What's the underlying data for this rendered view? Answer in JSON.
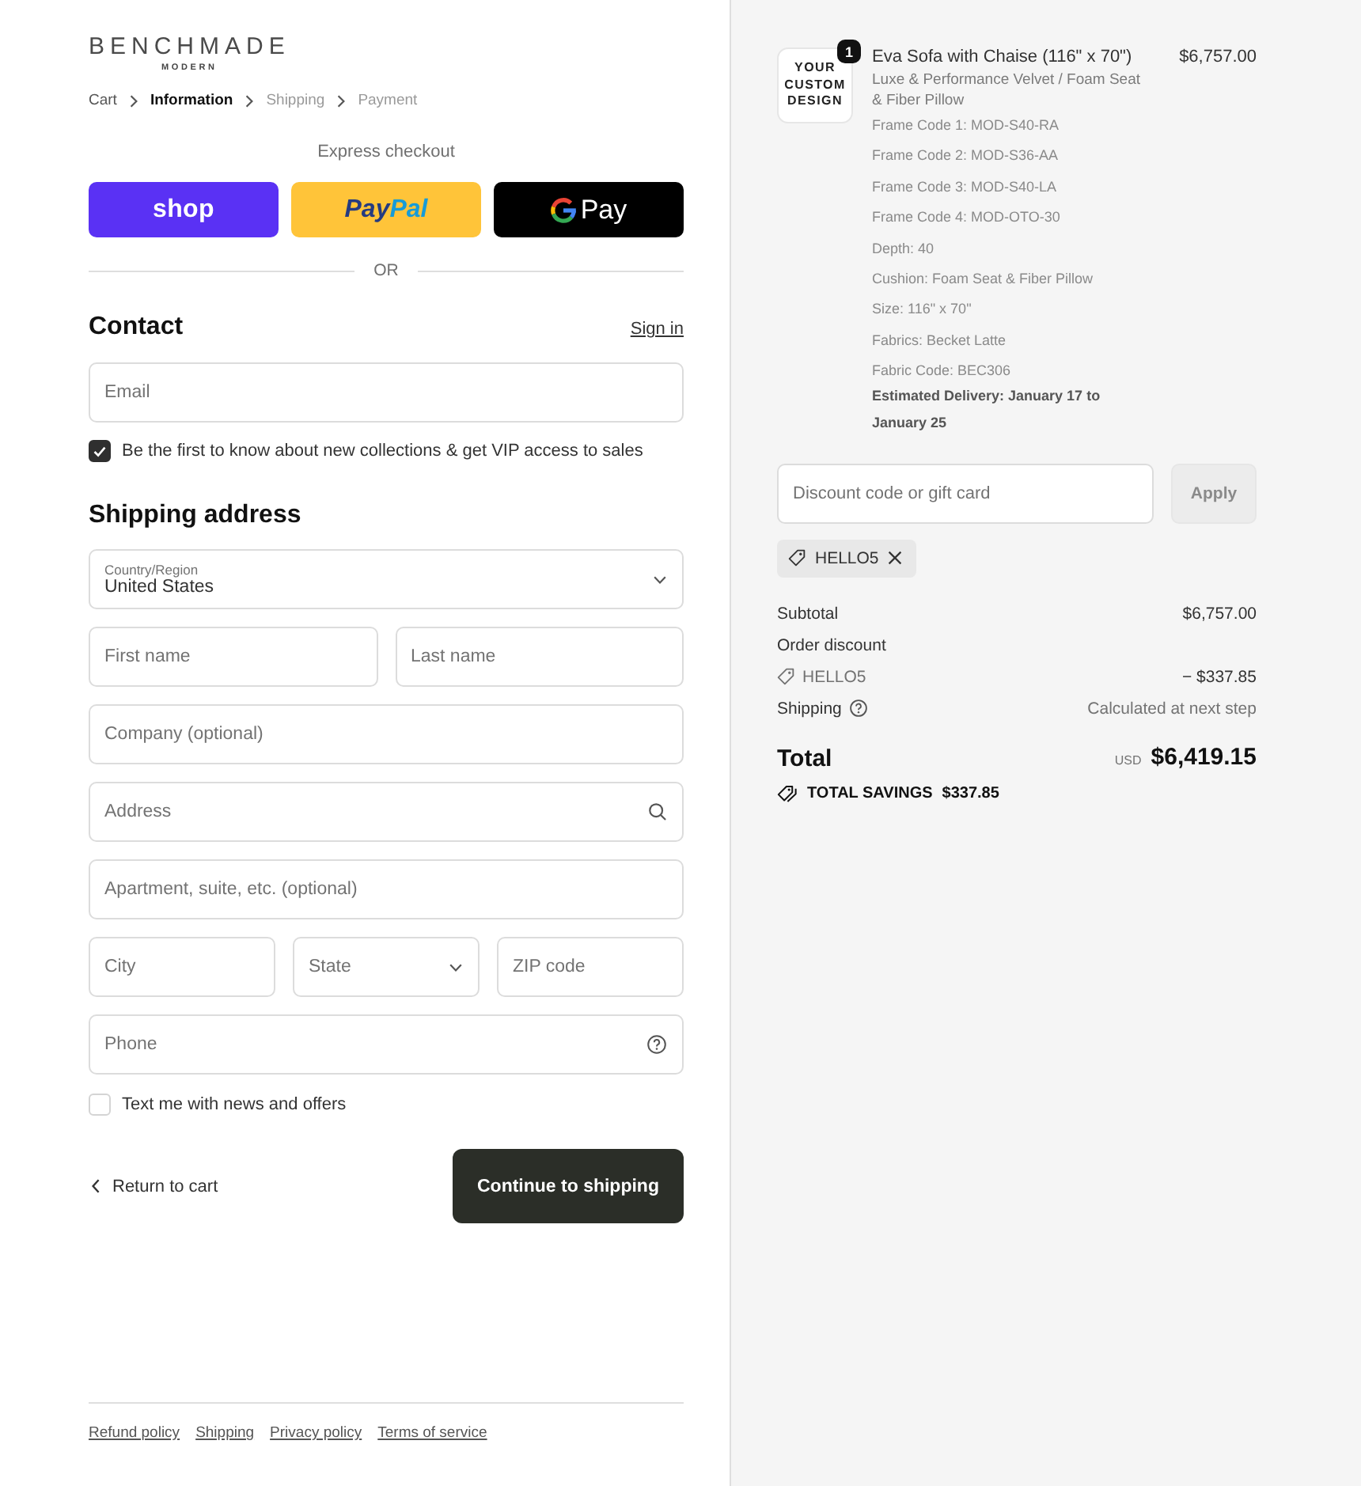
{
  "brand": {
    "name": "BENCHMADE",
    "tagline": "MODERN"
  },
  "breadcrumb": [
    {
      "label": "Cart",
      "selected": false,
      "completed": true
    },
    {
      "label": "Information",
      "selected": true,
      "completed": false
    },
    {
      "label": "Shipping",
      "selected": false,
      "completed": false
    },
    {
      "label": "Payment",
      "selected": false,
      "completed": false
    }
  ],
  "express_checkout": {
    "title": "Express checkout",
    "buttons": [
      {
        "kind": "shop",
        "label": "shop"
      },
      {
        "kind": "paypal",
        "label_parts": [
          "Pay",
          "Pal"
        ]
      },
      {
        "kind": "gpay",
        "label": "Pay"
      }
    ]
  },
  "divider": "OR",
  "contact": {
    "title": "Contact",
    "sign_in": "Sign in",
    "email": {
      "placeholder": "Email"
    },
    "marketing": {
      "label": "Be the first to know about new collections & get VIP access to sales",
      "checked": true
    }
  },
  "shipping_address": {
    "title": "Shipping address",
    "rows": [
      [
        {
          "kind": "select",
          "label": "Country/Region",
          "value": "United States"
        }
      ],
      [
        {
          "kind": "text",
          "placeholder": "First name"
        },
        {
          "kind": "text",
          "placeholder": "Last name"
        }
      ],
      [
        {
          "kind": "text",
          "placeholder": "Company (optional)"
        }
      ],
      [
        {
          "kind": "search",
          "placeholder": "Address"
        }
      ],
      [
        {
          "kind": "text",
          "placeholder": "Apartment, suite, etc. (optional)"
        }
      ],
      [
        {
          "kind": "text",
          "placeholder": "City"
        },
        {
          "kind": "select",
          "placeholder": "State"
        },
        {
          "kind": "text",
          "placeholder": "ZIP code"
        }
      ],
      [
        {
          "kind": "help",
          "placeholder": "Phone"
        }
      ]
    ]
  },
  "sms": {
    "label": "Text me with news and offers",
    "checked": false
  },
  "actions": {
    "back": "Return to cart",
    "continue": "Continue to shipping"
  },
  "footer_links": [
    "Refund policy",
    "Shipping",
    "Privacy policy",
    "Terms of service"
  ],
  "order": {
    "items": [
      {
        "thumbnail_text": "YOUR\nCUSTOM\nDESIGN",
        "quantity": "1",
        "title": "Eva Sofa with Chaise (116\" x 70\")",
        "price": "$6,757.00",
        "variant": "Luxe & Performance Velvet / Foam Seat & Fiber Pillow",
        "properties": [
          "Frame Code 1: MOD-S40-RA",
          "Frame Code 2: MOD-S36-AA",
          "Frame Code 3: MOD-S40-LA",
          "Frame Code 4: MOD-OTO-30",
          "Depth: 40",
          "Cushion: Foam Seat & Fiber Pillow",
          "Size: 116\" x 70\"",
          "Fabrics: Becket Latte",
          "Fabric Code: BEC306"
        ],
        "delivery": "Estimated Delivery: January 17 to January 25"
      }
    ],
    "discount": {
      "placeholder": "Discount code or gift card",
      "apply": {
        "label": "Apply",
        "disabled": true
      },
      "applied": [
        {
          "code": "HELLO5"
        }
      ]
    },
    "summary": {
      "subtotal": {
        "label": "Subtotal",
        "value": "$6,757.00"
      },
      "discount": {
        "label": "Order discount",
        "code": "HELLO5",
        "value": "− $337.85"
      },
      "shipping": {
        "label": "Shipping",
        "value": "Calculated at next step"
      },
      "total": {
        "label": "Total",
        "currency": "USD",
        "value": "$6,419.15"
      },
      "savings": {
        "label": "TOTAL SAVINGS",
        "value": "$337.85"
      }
    }
  }
}
